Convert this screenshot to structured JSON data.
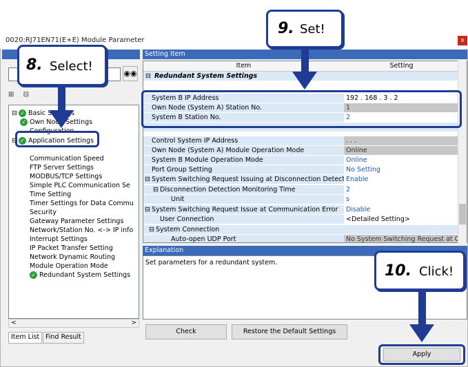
{
  "window": {
    "title": "0020:RJ71EN71(E+E) Module Parameter",
    "close_label": "x"
  },
  "left_pane": {
    "tree": [
      {
        "label": "Basic Settings",
        "level": 0,
        "checked": true,
        "expander": "-"
      },
      {
        "label": "Own Node Settings",
        "level": 1,
        "checked": true
      },
      {
        "label": "Configuration",
        "level": 2,
        "checked": false
      },
      {
        "label": "Application Settings",
        "level": 0,
        "checked": true,
        "expander": "-"
      },
      {
        "label": "Communication Speed",
        "level": 2
      },
      {
        "label": "FTP Server Settings",
        "level": 2
      },
      {
        "label": "MODBUS/TCP Settings",
        "level": 2
      },
      {
        "label": "Simple PLC Communication Se",
        "level": 2
      },
      {
        "label": "Time Setting",
        "level": 2
      },
      {
        "label": "Timer Settings for Data Commu",
        "level": 2
      },
      {
        "label": "Security",
        "level": 2
      },
      {
        "label": "Gateway Parameter Settings",
        "level": 2
      },
      {
        "label": "Network/Station No. <-> IP info",
        "level": 2
      },
      {
        "label": "Interrupt Settings",
        "level": 2
      },
      {
        "label": "IP Packet Transfer Setting",
        "level": 2
      },
      {
        "label": "Network Dynamic Routing",
        "level": 2
      },
      {
        "label": "Module Operation Mode",
        "level": 2
      },
      {
        "label": "Redundant System Settings",
        "level": 2,
        "checked": true
      }
    ],
    "tabs": [
      "Item List",
      "Find Result"
    ]
  },
  "setting_panel": {
    "header": "Setting Item",
    "col_item": "Item",
    "col_setting": "Setting",
    "group": "Redundant System Settings",
    "rows": [
      {
        "label": "System B IP Address",
        "value": "192 . 168 . 3 . 2",
        "style": "black"
      },
      {
        "label": "Own Node (System A) Station No.",
        "value": "1",
        "style": "gray"
      },
      {
        "label": "System B Station No.",
        "value": "2",
        "style": "blue"
      },
      {
        "label": "",
        "value": "",
        "style": "blank"
      },
      {
        "label": "Control System IP Address",
        "value": ". . .",
        "style": "gray"
      },
      {
        "label": "Own Node (System A) Module Operation Mode",
        "value": "Online",
        "style": "gray"
      },
      {
        "label": "System B Module Operation Mode",
        "value": "Online",
        "style": "blue"
      },
      {
        "label": "Port Group Setting",
        "value": "No Setting",
        "style": "blue"
      },
      {
        "label": "System Switching Request Issuing at Disconnection Detection",
        "value": "Enable",
        "style": "blue",
        "expander": "-"
      },
      {
        "label": "Disconnection Detection Monitoring Time",
        "value": "2",
        "style": "blue",
        "expander": "-"
      },
      {
        "label": "Unit",
        "value": "s",
        "style": "blue"
      },
      {
        "label": "System Switching Request Issue at Communication Error",
        "value": "Disable",
        "style": "blue",
        "expander": "-"
      },
      {
        "label": "User Connection",
        "value": "<Detailed Setting>",
        "style": "black"
      },
      {
        "label": "System Connection",
        "value": "",
        "style": "blank",
        "expander": "-"
      },
      {
        "label": "Auto-open UDP Port",
        "value": "No System Switching Request at Com",
        "style": "gray"
      }
    ]
  },
  "explanation": {
    "header": "Explanation",
    "text": "Set parameters for a redundant system."
  },
  "buttons": {
    "check": "Check",
    "restore": "Restore the Default Settings",
    "apply": "Apply"
  },
  "callouts": {
    "select": {
      "num": "8.",
      "text": "Select!"
    },
    "set": {
      "num": "9.",
      "text": "Set!"
    },
    "click": {
      "num": "10.",
      "text": "Click!"
    }
  },
  "colors": {
    "accent": "#1f3b93",
    "header_blue": "#3b6ab8",
    "value_blue": "#1c55c8"
  }
}
